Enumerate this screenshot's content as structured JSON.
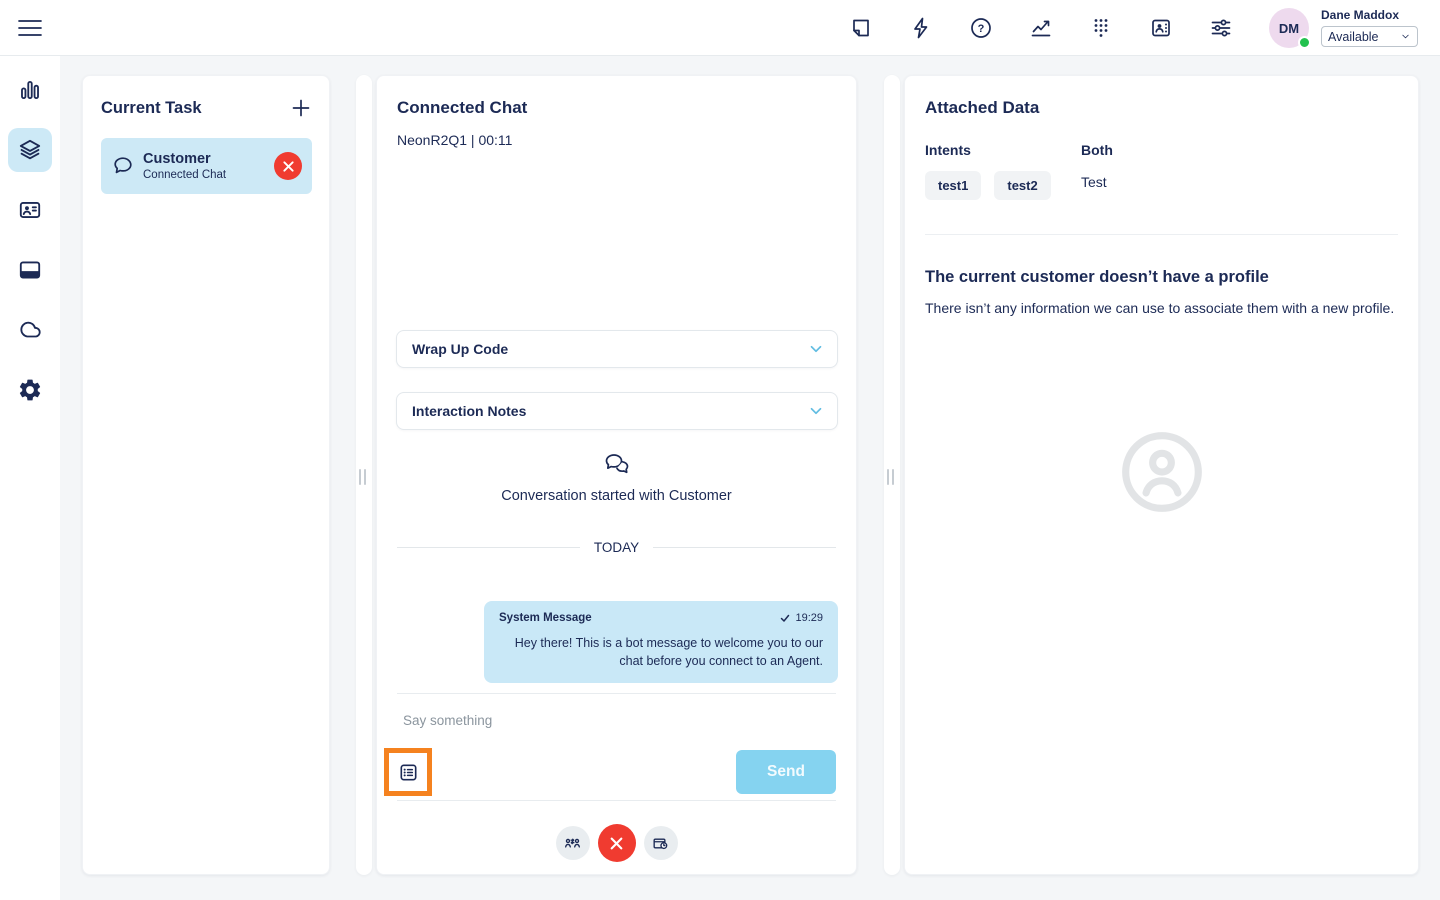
{
  "topbar": {
    "icons": [
      "note-icon",
      "quick-reply-icon",
      "help-icon",
      "performance-icon",
      "dialpad-icon",
      "contacts-icon",
      "preferences-icon"
    ],
    "user": {
      "initials": "DM",
      "name": "Dane Maddox",
      "status": "Available"
    }
  },
  "sidebar": {
    "icons": [
      "menu-icon",
      "activity-icon",
      "interactions-icon",
      "contacts-icon",
      "apps-icon",
      "cloud-icon",
      "settings-icon"
    ],
    "active_item": "interactions"
  },
  "current_task": {
    "title": "Current Task",
    "task": {
      "title": "Customer",
      "subtitle": "Connected Chat"
    }
  },
  "chat": {
    "title": "Connected Chat",
    "session_info": "NeonR2Q1 | 00:11",
    "wrap_up_label": "Wrap Up Code",
    "interaction_notes_label": "Interaction Notes",
    "conversation_started": "Conversation started with Customer",
    "day_divider": "TODAY",
    "message": {
      "sender": "System Message",
      "time": "19:29",
      "text": "Hey there! This is a bot message to welcome you to our chat before you connect to an Agent."
    },
    "input_placeholder": "Say something",
    "send_label": "Send"
  },
  "attached_data": {
    "title": "Attached Data",
    "intents_label": "Intents",
    "intents": [
      "test1",
      "test2"
    ],
    "both_label": "Both",
    "both_value": "Test",
    "no_profile_title": "The current customer doesn’t have a profile",
    "no_profile_text": "There isn’t any information we can use to associate them with a new profile."
  },
  "colors": {
    "navy": "#1c2a55",
    "light_blue": "#c9e8f7",
    "send_blue": "#85d3f0",
    "danger_red": "#f03b30",
    "highlight_orange": "#f5821f",
    "status_green": "#22c14e",
    "avatar_pink": "#eedaee",
    "page_bg": "#f4f6f8"
  }
}
